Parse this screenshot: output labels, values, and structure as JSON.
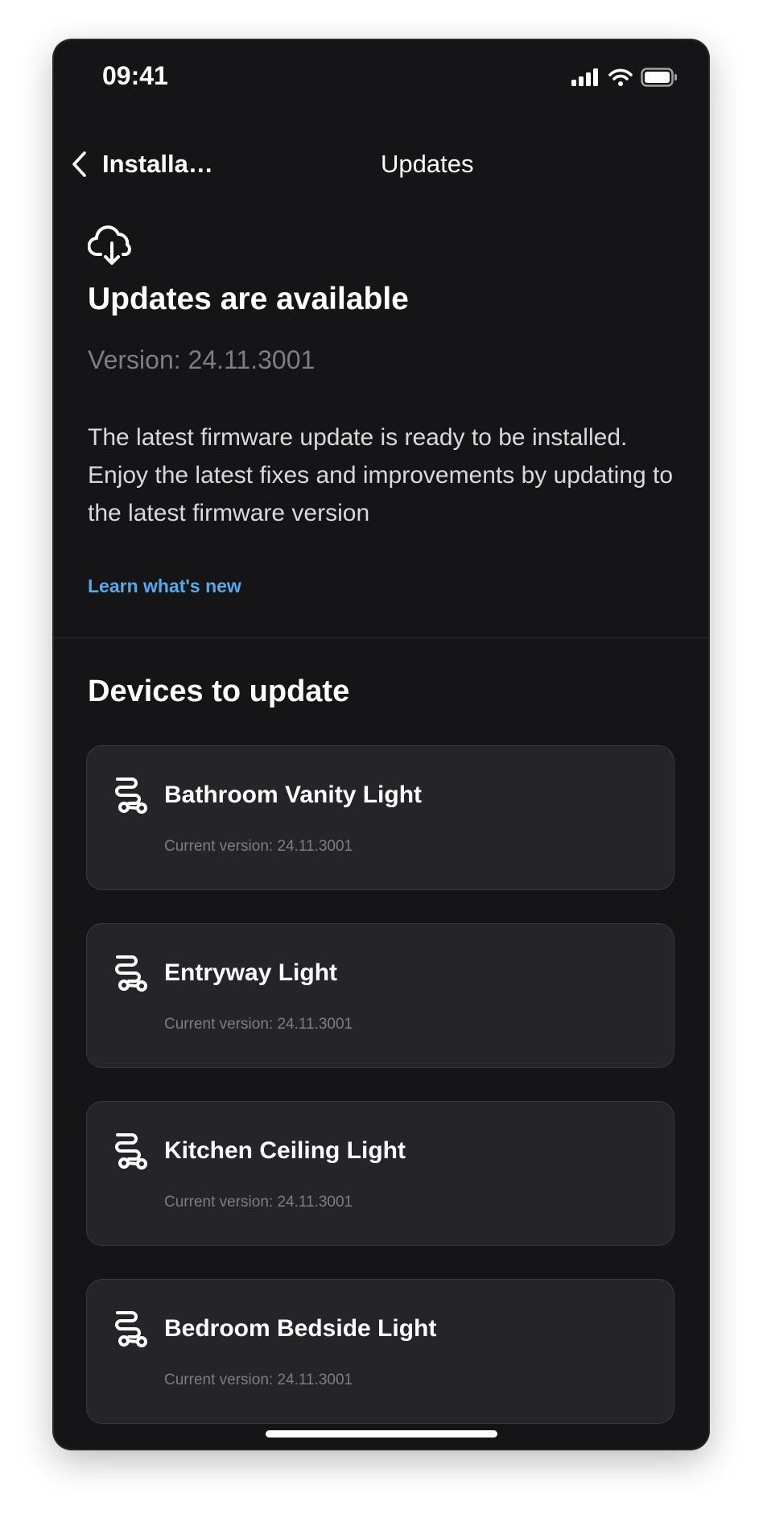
{
  "status_bar": {
    "time": "09:41"
  },
  "nav": {
    "back_label": "Installa…",
    "title": "Updates"
  },
  "header": {
    "headline": "Updates are available",
    "version": "Version: 24.11.3001",
    "description": "The latest firmware update is ready to be installed. Enjoy the latest fixes and improvements by updating to the latest firmware version",
    "learn_link": "Learn what's new"
  },
  "devices": {
    "title": "Devices to update",
    "items": [
      {
        "name": "Bathroom Vanity Light",
        "version": "Current version: 24.11.3001",
        "icon": "device-chain-icon"
      },
      {
        "name": "Entryway Light",
        "version": "Current version: 24.11.3001",
        "icon": "device-chain-icon"
      },
      {
        "name": "Kitchen Ceiling Light",
        "version": "Current version: 24.11.3001",
        "icon": "device-chain-icon"
      },
      {
        "name": "Bedroom Bedside Light",
        "version": "Current version: 24.11.3001",
        "icon": "device-chain-icon"
      }
    ]
  },
  "colors": {
    "background": "#151417",
    "card": "#252428",
    "accent": "#5aa9e6",
    "muted": "#7e7d83"
  }
}
